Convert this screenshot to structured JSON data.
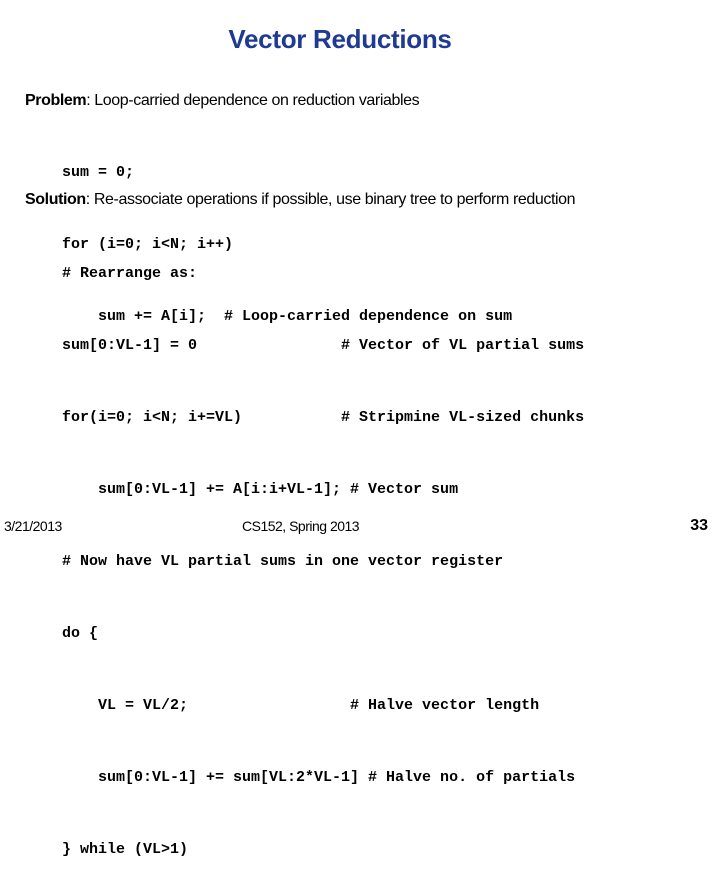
{
  "slide": {
    "title": "Vector Reductions",
    "problem": {
      "label": "Problem",
      "text": ": Loop-carried dependence on reduction variables",
      "code": [
        "sum = 0;",
        "for (i=0; i<N; i++)",
        "    sum += A[i];  # Loop-carried dependence on sum"
      ]
    },
    "solution": {
      "label": "Solution",
      "text": ": Re-associate operations if possible, use binary tree to perform reduction",
      "code": [
        "# Rearrange as:",
        "sum[0:VL-1] = 0                # Vector of VL partial sums",
        "for(i=0; i<N; i+=VL)           # Stripmine VL-sized chunks",
        "    sum[0:VL-1] += A[i:i+VL-1]; # Vector sum",
        "# Now have VL partial sums in one vector register",
        "do {",
        "    VL = VL/2;                  # Halve vector length",
        "    sum[0:VL-1] += sum[VL:2*VL-1] # Halve no. of partials",
        "} while (VL>1)"
      ]
    }
  },
  "footer": {
    "date": "3/21/2013",
    "course": "CS152, Spring 2013",
    "page_number": "33"
  }
}
